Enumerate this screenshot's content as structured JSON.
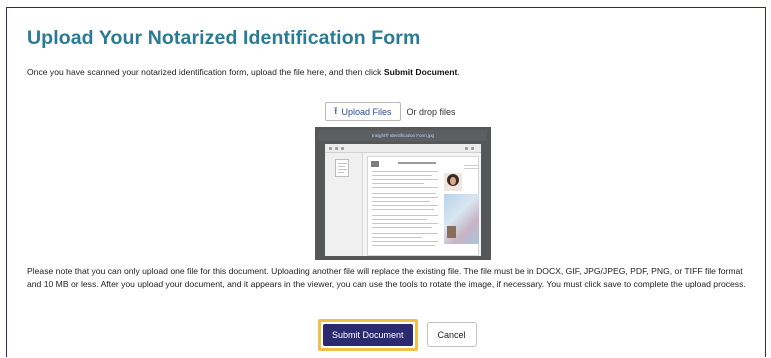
{
  "page": {
    "title": "Upload Your Notarized Identification Form",
    "intro_text": "Once you have scanned your notarized identification form, upload the file here, and then click",
    "intro_bold": "Submit Document",
    "intro_end": "."
  },
  "upload": {
    "upload_label": "Upload Files",
    "drop_label": "Or drop files",
    "icon": "upload-icon"
  },
  "viewer": {
    "file_name": "Insight® Identification Form.jpg",
    "document_heading": "Insight® Identification Form"
  },
  "note": {
    "text": "Please note that you can only upload one file for this document. Uploading another file will replace the existing file. The file must be in DOCX, GIF, JPG/JPEG, PDF, PNG, or TIFF file format and 10 MB or less. After you upload your document, and it appears in the viewer, you can use the tools to rotate the image, if necessary. You must click save to complete the upload process."
  },
  "actions": {
    "submit_label": "Submit Document",
    "cancel_label": "Cancel"
  },
  "colors": {
    "title": "#2a7b95",
    "frame_border": "#2d2a6b",
    "submit_bg": "#2c2a6f",
    "highlight": "#f0c048"
  }
}
